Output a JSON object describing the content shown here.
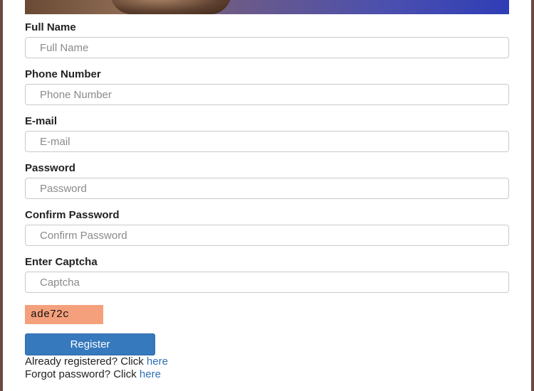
{
  "form": {
    "fields": [
      {
        "label": "Full Name",
        "placeholder": "Full Name",
        "value": ""
      },
      {
        "label": "Phone Number",
        "placeholder": "Phone Number",
        "value": ""
      },
      {
        "label": "E-mail",
        "placeholder": "E-mail",
        "value": ""
      },
      {
        "label": "Password",
        "placeholder": "Password",
        "value": ""
      },
      {
        "label": "Confirm Password",
        "placeholder": "Confirm Password",
        "value": ""
      },
      {
        "label": "Enter Captcha",
        "placeholder": "Captcha",
        "value": ""
      }
    ],
    "captcha_code": "ade72c",
    "register_label": "Register"
  },
  "footer": {
    "already_text": "Already registered? Click ",
    "already_link": "here",
    "forgot_text": "Forgot password? Click ",
    "forgot_link": "here"
  },
  "colors": {
    "button": "#3679bd",
    "link": "#2f6fb5",
    "captcha_bg": "#f5a07c",
    "frame_border": "#6b4a3f"
  }
}
